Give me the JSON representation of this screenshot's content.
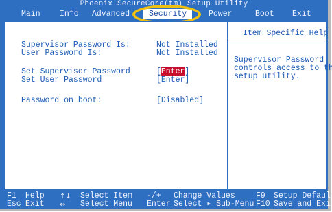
{
  "title": "Phoenix SecureCore(tm) Setup Utility",
  "menu": {
    "items": [
      {
        "label": "Main"
      },
      {
        "label": "Info"
      },
      {
        "label": "Advanced"
      },
      {
        "label": "Security"
      },
      {
        "label": "Power"
      },
      {
        "label": "Boot"
      },
      {
        "label": "Exit"
      }
    ],
    "selected": "Security"
  },
  "settings": {
    "supervisor_password_is": {
      "label": "Supervisor Password Is:",
      "value": "Not Installed"
    },
    "user_password_is": {
      "label": "User Password Is:",
      "value": "Not Installed"
    },
    "set_supervisor_password": {
      "label": "Set Supervisor Password",
      "value": "Enter"
    },
    "set_user_password": {
      "label": "Set User Password",
      "value": "[Enter]"
    },
    "password_on_boot": {
      "label": "Password on boot:",
      "value": "[Disabled]"
    }
  },
  "help": {
    "title": "Item Specific Help",
    "lines": [
      "Supervisor Password",
      "controls access to the",
      "setup utility."
    ]
  },
  "footer": {
    "row1": {
      "k1": "F1",
      "l1": "Help",
      "k2": "↑↓",
      "l2": "Select Item",
      "k3": "-/+",
      "l3": "Change Values",
      "k4": "F9",
      "l4": "Setup Defaults"
    },
    "row2": {
      "k1": "Esc",
      "l1": "Exit",
      "k2": "↔",
      "l2": "Select Menu",
      "k3": "Enter",
      "l3": "Select ▸ Sub-Menu",
      "k4": "F10",
      "l4": "Save and Exit"
    }
  },
  "colors": {
    "background": "#2f6fc2",
    "text_blue": "#1f5cb5",
    "highlight": "#f0c010",
    "selected_field": "#c8102e"
  }
}
